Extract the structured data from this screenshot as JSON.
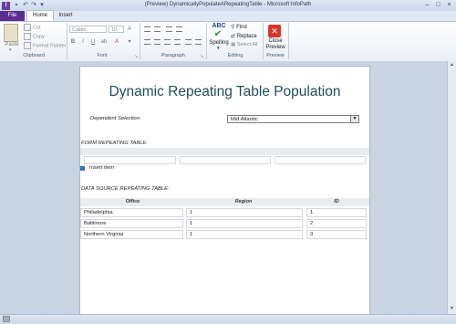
{
  "window": {
    "title": "(Preview) DynamicallyPopulateARepeatingTable - Microsoft InfoPath",
    "app_icon_letter": "I"
  },
  "tabs": [
    "File",
    "Home",
    "Insert"
  ],
  "ribbon": {
    "clipboard": {
      "paste": "Paste",
      "cut": "Cut",
      "copy": "Copy",
      "format_painter": "Format Painter",
      "label": "Clipboard"
    },
    "font": {
      "name": "Calibri",
      "size": "10",
      "label": "Font",
      "bold": "B",
      "italic": "I",
      "underline": "U"
    },
    "paragraph": {
      "label": "Paragraph"
    },
    "editing": {
      "spelling": "Spelling",
      "spelling_icon": "ABC",
      "find": "Find",
      "replace": "Replace",
      "select_all": "Select All",
      "label": "Editing"
    },
    "preview": {
      "close_preview_line1": "Close",
      "close_preview_line2": "Preview",
      "label": "Preview"
    }
  },
  "document": {
    "title": "Dynamic Repeating Table Population",
    "dependent_label": "Dependent Selection:",
    "dependent_value": "Mid Atlantic",
    "form_table_label": "FORM REPEATING TABLE:",
    "insert_item": "Insert item",
    "ds_table_label": "DATA SOURCE REPEATING TABLE:",
    "ds_table": {
      "headers": [
        "Office",
        "Region",
        "ID"
      ],
      "rows": [
        [
          "Philadelphia",
          "1",
          "1"
        ],
        [
          "Baltimore",
          "1",
          "2"
        ],
        [
          "Northern Virginia",
          "1",
          "3"
        ]
      ]
    }
  },
  "colors": {
    "file_tab": "#5b2d8e",
    "title_text": "#1f4e5a",
    "close_preview_icon": "#d9362b"
  }
}
